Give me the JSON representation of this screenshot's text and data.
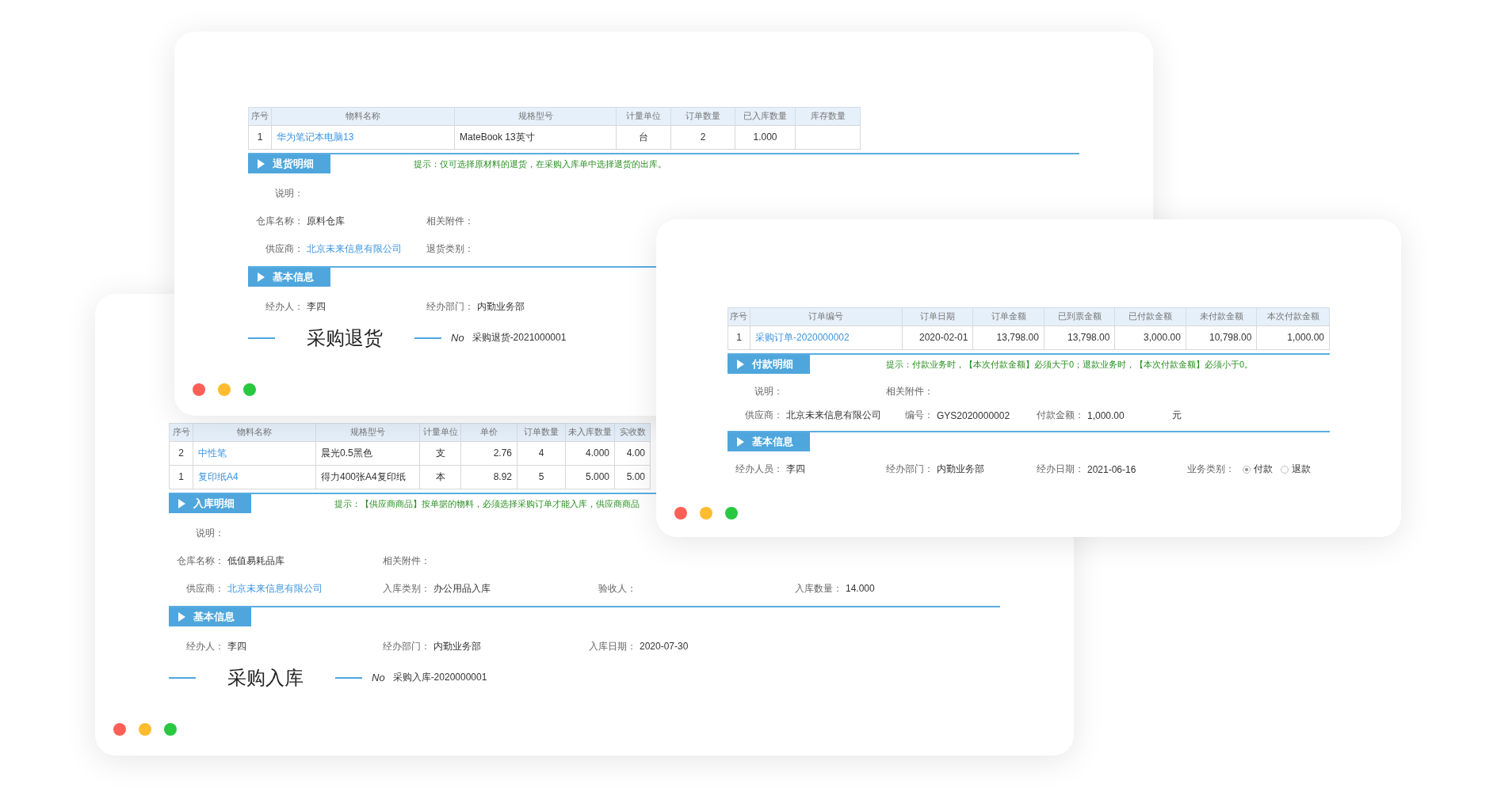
{
  "windows": [
    {
      "table": {
        "rows": [
          [
            "1",
            "华为笔记本电脑13",
            "MateBook 13英寸",
            "台",
            "2",
            "1.000"
          ]
        ],
        "columns": [
          {
            "label": "序号",
            "kind": "index"
          },
          {
            "label": "物料名称",
            "kind": "link"
          },
          {
            "label": "规格型号",
            "kind": "text"
          },
          {
            "label": "计量单位",
            "kind": "center"
          },
          {
            "label": "订单数量",
            "kind": "center"
          },
          {
            "label": "已入库数量",
            "kind": "center"
          },
          {
            "label": "库存数量",
            "kind": "center"
          }
        ]
      },
      "detail_section": "退货明细",
      "hint": "提示：仅可选择原材料的退货，在采购入库单中选择退货的出库。",
      "basic_rows": [
        [
          {
            "label": "说明：",
            "kind": "text"
          }
        ],
        [
          {
            "label": "仓库名称：",
            "value": "原料仓库",
            "kind": "text"
          },
          {
            "label": "相关附件：",
            "kind": "text"
          }
        ],
        [
          {
            "label": "供应商：",
            "value": "北京未来信息有限公司",
            "kind": "link"
          },
          {
            "label": "退货类别：",
            "kind": "text"
          }
        ]
      ],
      "basic_section": "基本信息",
      "handler_rows": [
        [
          {
            "label": "经办人：",
            "value": "李四",
            "kind": "text"
          },
          {
            "label": "经办部门：",
            "value": "内勤业务部",
            "kind": "text"
          }
        ]
      ],
      "heading": "采购退货",
      "number_label": "No",
      "number": "采购退货-2021000001"
    },
    {
      "table": {
        "rows": [
          [
            "1",
            "采购订单-2020000002",
            "2020-02-01",
            "13,798.00",
            "13,798.00",
            "3,000.00",
            "10,798.00",
            "1,000.00"
          ]
        ],
        "columns": [
          {
            "label": "序号",
            "kind": "index"
          },
          {
            "label": "订单编号",
            "kind": "link"
          },
          {
            "label": "订单日期",
            "kind": "number"
          },
          {
            "label": "订单金额",
            "kind": "number"
          },
          {
            "label": "已到票金额",
            "kind": "number"
          },
          {
            "label": "已付款金额",
            "kind": "number"
          },
          {
            "label": "未付款金额",
            "kind": "number"
          },
          {
            "label": "本次付款金额",
            "kind": "number"
          }
        ]
      },
      "detail_section": "付款明细",
      "hint": "提示：付款业务时，【本次付款金额】必须大于0；退款业务时，【本次付款金额】必须小于0。",
      "basic_rows": [
        [
          {
            "label": "说明：",
            "kind": "text"
          },
          {
            "label": "相关附件：",
            "kind": "text"
          }
        ],
        [
          {
            "label": "供应商：",
            "value": "北京未来信息有限公司",
            "kind": "text"
          },
          {
            "label": "编号：",
            "value": "GYS2020000002",
            "kind": "text"
          },
          {
            "label": "付款金额：",
            "value": "1,000.00",
            "kind": "amount",
            "unit": "元"
          }
        ]
      ],
      "basic_section": "基本信息",
      "handler_rows": [
        [
          {
            "label": "经办人员：",
            "value": "李四",
            "kind": "text"
          },
          {
            "label": "经办部门：",
            "value": "内勤业务部",
            "kind": "text"
          },
          {
            "label": "经办日期：",
            "value": "2021-06-16",
            "kind": "text"
          },
          {
            "label": "业务类别：",
            "kind": "radio",
            "options": [
              {
                "label": "付款",
                "selected": true
              },
              {
                "label": "退款",
                "selected": false
              }
            ]
          }
        ]
      ]
    },
    {
      "table": {
        "rows": [
          [
            "2",
            "中性笔",
            "晨光0.5黑色",
            "支",
            "2.76",
            "4",
            "4.000",
            "4.00"
          ],
          [
            "1",
            "复印纸A4",
            "得力400张A4复印纸",
            "本",
            "8.92",
            "5",
            "5.000",
            "5.00"
          ]
        ],
        "columns": [
          {
            "label": "序号",
            "kind": "index"
          },
          {
            "label": "物料名称",
            "kind": "link"
          },
          {
            "label": "规格型号",
            "kind": "text"
          },
          {
            "label": "计量单位",
            "kind": "center"
          },
          {
            "label": "单价",
            "kind": "number"
          },
          {
            "label": "订单数量",
            "kind": "center"
          },
          {
            "label": "未入库数量",
            "kind": "number"
          },
          {
            "label": "实收数",
            "kind": "number"
          }
        ]
      },
      "detail_section": "入库明细",
      "hint": "提示：【供应商商品】按单据的物料，必须选择采购订单才能入库，供应商商品",
      "basic_rows": [
        [
          {
            "label": "说明：",
            "kind": "text"
          }
        ],
        [
          {
            "label": "仓库名称：",
            "value": "低值易耗品库",
            "kind": "text"
          },
          {
            "label": "相关附件：",
            "kind": "text"
          }
        ],
        [
          {
            "label": "供应商：",
            "value": "北京未来信息有限公司",
            "kind": "link"
          },
          {
            "label": "入库类别：",
            "value": "办公用品入库",
            "kind": "text"
          },
          {
            "label": "验收人：",
            "kind": "text"
          },
          {
            "label": "入库数量：",
            "value": "14.000",
            "kind": "text"
          }
        ]
      ],
      "basic_section": "基本信息",
      "handler_rows": [
        [
          {
            "label": "经办人：",
            "value": "李四",
            "kind": "text"
          },
          {
            "label": "经办部门：",
            "value": "内勤业务部",
            "kind": "text"
          },
          {
            "label": "入库日期：",
            "value": "2020-07-30",
            "kind": "text"
          }
        ]
      ],
      "heading": "采购入库",
      "number_label": "No",
      "number": "采购入库-2020000001"
    }
  ]
}
